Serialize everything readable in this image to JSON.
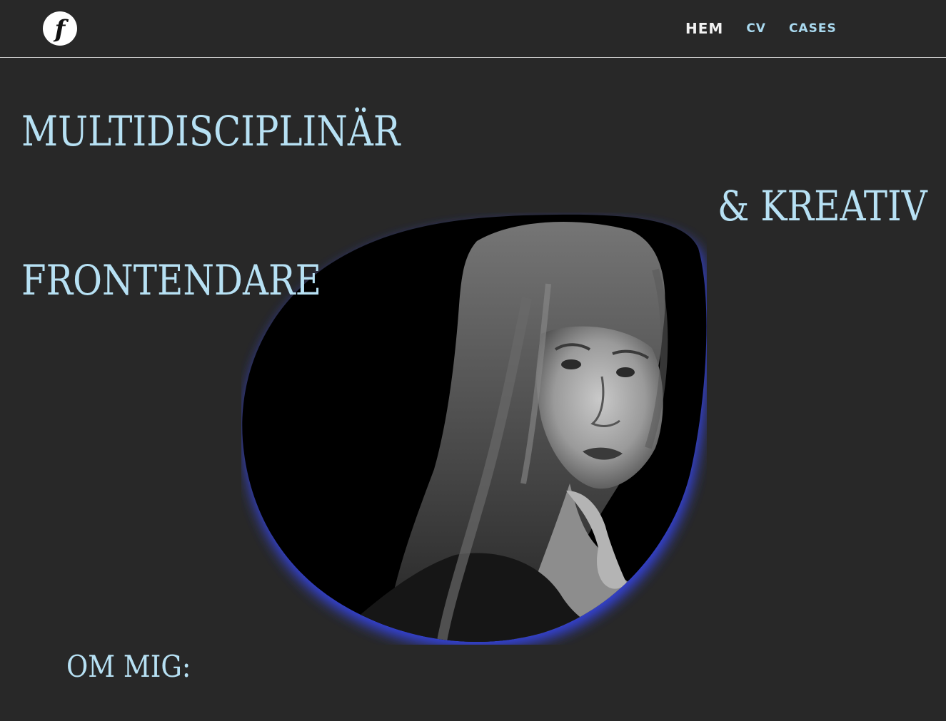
{
  "header": {
    "logo_letter": "f",
    "nav": {
      "home": "HEM",
      "cv": "CV",
      "cases": "CASES"
    }
  },
  "hero": {
    "line1": "MULTIDISCIPLINÄR",
    "line2": "& KREATIV",
    "line3": "FRONTENDARE"
  },
  "about": {
    "heading": "OM MIG:"
  },
  "colors": {
    "background": "#282828",
    "accent": "#b7e1f4",
    "nav_active": "#f2f2f2",
    "glow": "#3b4bf5"
  },
  "icons": {
    "logo": "logo-icon",
    "portrait": "portrait-photo"
  }
}
